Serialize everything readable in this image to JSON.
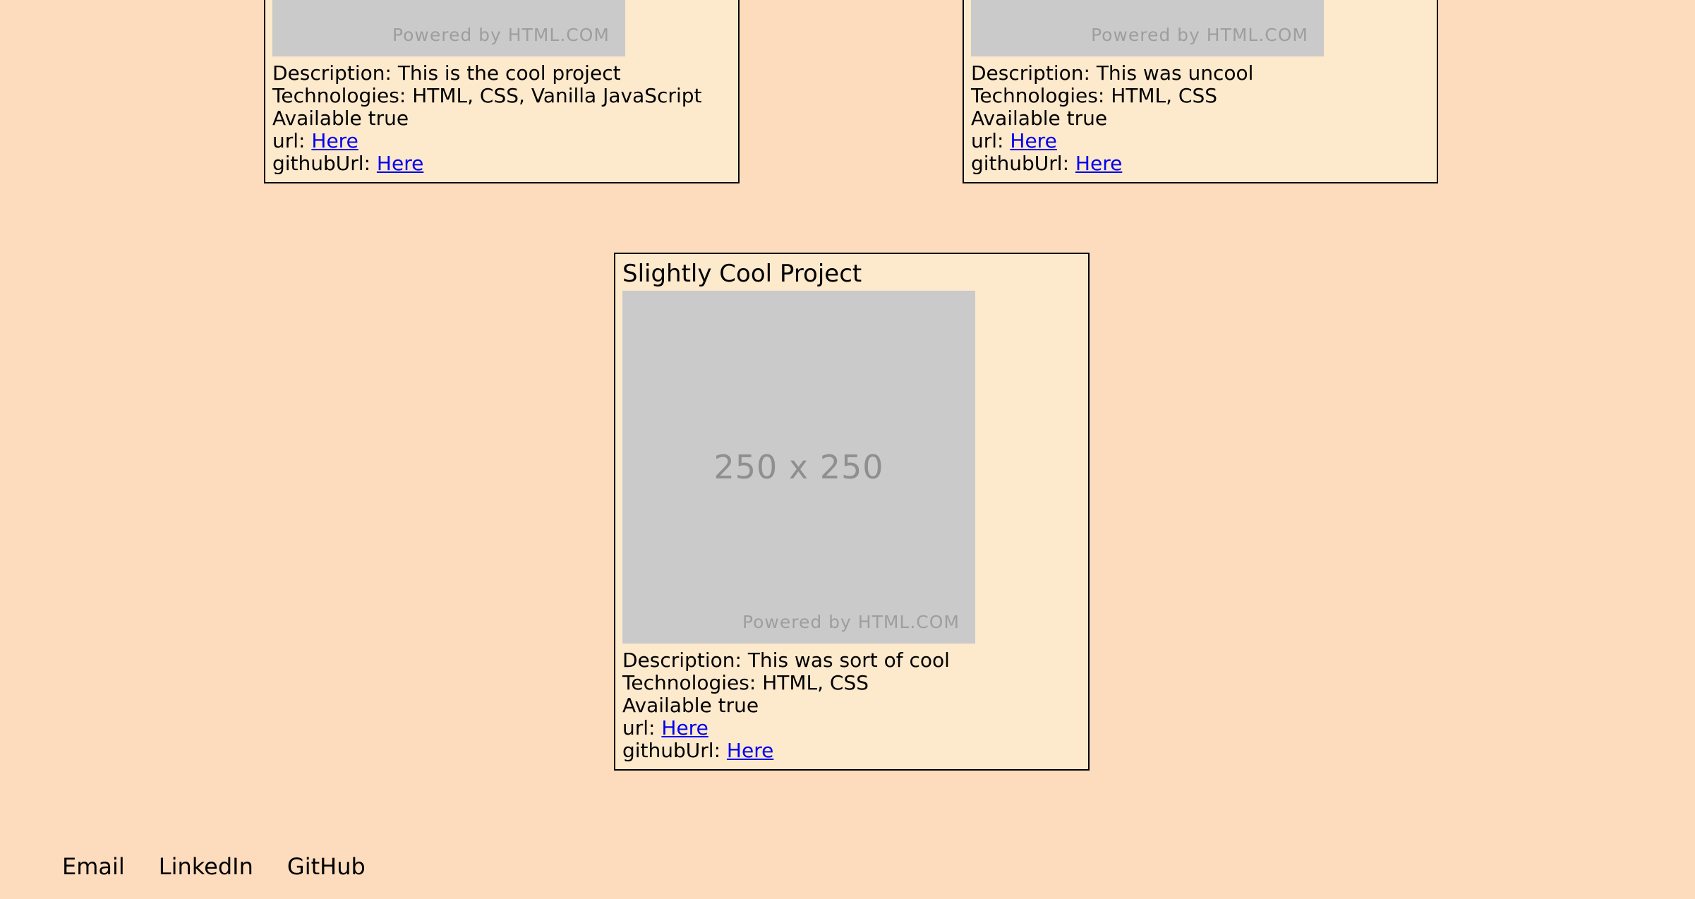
{
  "projects": [
    {
      "placeholder_powered": "Powered by HTML.COM",
      "description_label": "Description:",
      "description": "This is the cool project",
      "technologies_label": "Technologies:",
      "technologies": "HTML, CSS, Vanilla JavaScript",
      "available_label": "Available",
      "available": "true",
      "url_label": "url:",
      "url_link": "Here",
      "github_label": "githubUrl:",
      "github_link": "Here"
    },
    {
      "placeholder_powered": "Powered by HTML.COM",
      "description_label": "Description:",
      "description": "This was uncool",
      "technologies_label": "Technologies:",
      "technologies": "HTML, CSS",
      "available_label": "Available",
      "available": "true",
      "url_label": "url:",
      "url_link": "Here",
      "github_label": "githubUrl:",
      "github_link": "Here"
    },
    {
      "title": "Slightly Cool Project",
      "placeholder_size": "250 x 250",
      "placeholder_powered": "Powered by HTML.COM",
      "description_label": "Description:",
      "description": "This was sort of cool",
      "technologies_label": "Technologies:",
      "technologies": "HTML, CSS",
      "available_label": "Available",
      "available": "true",
      "url_label": "url:",
      "url_link": "Here",
      "github_label": "githubUrl:",
      "github_link": "Here"
    }
  ],
  "footer": {
    "links": [
      "Email",
      "LinkedIn",
      "GitHub"
    ]
  },
  "colors": {
    "background": "#fddcbe",
    "card_background": "#fde9cc",
    "link": "#0000ee",
    "placeholder": "#cacaca"
  }
}
